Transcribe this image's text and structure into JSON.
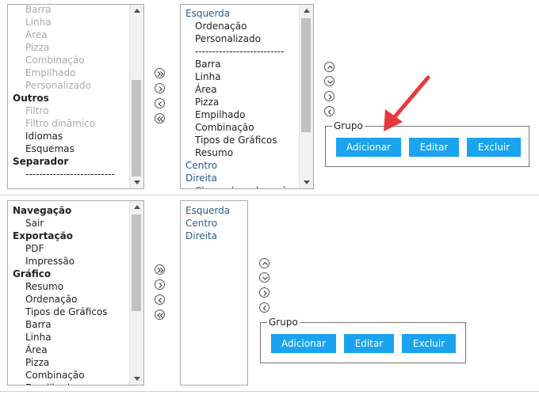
{
  "top": {
    "left_list": [
      {
        "label": "Barra",
        "kind": "disabled",
        "indent": 1
      },
      {
        "label": "Linha",
        "kind": "disabled",
        "indent": 1
      },
      {
        "label": "Área",
        "kind": "disabled",
        "indent": 1
      },
      {
        "label": "Pizza",
        "kind": "disabled",
        "indent": 1
      },
      {
        "label": "Combinação",
        "kind": "disabled",
        "indent": 1
      },
      {
        "label": "Empilhado",
        "kind": "disabled",
        "indent": 1
      },
      {
        "label": "Personalizado",
        "kind": "disabled",
        "indent": 1
      },
      {
        "label": "Outros",
        "kind": "group",
        "indent": 0
      },
      {
        "label": "Filtro",
        "kind": "disabled",
        "indent": 1
      },
      {
        "label": "Filtro dinâmico",
        "kind": "disabled",
        "indent": 1
      },
      {
        "label": "Idiomas",
        "kind": "active",
        "indent": 1
      },
      {
        "label": "Esquemas",
        "kind": "active",
        "indent": 1
      },
      {
        "label": "Separador",
        "kind": "group",
        "indent": 0
      },
      {
        "label": "--------------------------",
        "kind": "active",
        "indent": 1
      }
    ],
    "right_list": [
      {
        "label": "Esquerda",
        "kind": "blue",
        "indent": 0
      },
      {
        "label": "Ordenação",
        "kind": "active",
        "indent": 2
      },
      {
        "label": "Personalizado",
        "kind": "active",
        "indent": 2
      },
      {
        "label": "--------------------------",
        "kind": "active",
        "indent": 2
      },
      {
        "label": "Barra",
        "kind": "active",
        "indent": 2
      },
      {
        "label": "Linha",
        "kind": "active",
        "indent": 2
      },
      {
        "label": "Área",
        "kind": "active",
        "indent": 2
      },
      {
        "label": "Pizza",
        "kind": "active",
        "indent": 2
      },
      {
        "label": "Empilhado",
        "kind": "active",
        "indent": 2
      },
      {
        "label": "Combinação",
        "kind": "active",
        "indent": 2
      },
      {
        "label": "Tipos de Gráficos",
        "kind": "active",
        "indent": 2
      },
      {
        "label": "Resumo",
        "kind": "active",
        "indent": 2
      },
      {
        "label": "Centro",
        "kind": "blue",
        "indent": 0
      },
      {
        "label": "Direita",
        "kind": "blue",
        "indent": 0
      },
      {
        "label": "Chave de ordenação",
        "kind": "blue",
        "indent": 2
      }
    ],
    "group_legend": "Grupo",
    "buttons": {
      "add": "Adicionar",
      "edit": "Editar",
      "delete": "Excluir"
    }
  },
  "bottom": {
    "left_list": [
      {
        "label": "Navegação",
        "kind": "group",
        "indent": 0
      },
      {
        "label": "Sair",
        "kind": "active",
        "indent": 1
      },
      {
        "label": "Exportação",
        "kind": "group",
        "indent": 0
      },
      {
        "label": "PDF",
        "kind": "active",
        "indent": 1
      },
      {
        "label": "Impressão",
        "kind": "active",
        "indent": 1
      },
      {
        "label": "Gráfico",
        "kind": "group",
        "indent": 0
      },
      {
        "label": "Resumo",
        "kind": "active",
        "indent": 1
      },
      {
        "label": "Ordenação",
        "kind": "active",
        "indent": 1
      },
      {
        "label": "Tipos de Gráficos",
        "kind": "active",
        "indent": 1
      },
      {
        "label": "Barra",
        "kind": "active",
        "indent": 1
      },
      {
        "label": "Linha",
        "kind": "active",
        "indent": 1
      },
      {
        "label": "Área",
        "kind": "active",
        "indent": 1
      },
      {
        "label": "Pizza",
        "kind": "active",
        "indent": 1
      },
      {
        "label": "Combinação",
        "kind": "active",
        "indent": 1
      },
      {
        "label": "Empilhado",
        "kind": "active",
        "indent": 1
      }
    ],
    "right_list": [
      {
        "label": "Esquerda",
        "kind": "blue",
        "indent": 0
      },
      {
        "label": "Centro",
        "kind": "blue",
        "indent": 0
      },
      {
        "label": "Direita",
        "kind": "blue",
        "indent": 0
      }
    ],
    "group_legend": "Grupo",
    "buttons": {
      "add": "Adicionar",
      "edit": "Editar",
      "delete": "Excluir"
    }
  },
  "colors": {
    "button": "#1aa3ef",
    "annotation_arrow": "#e8393a",
    "section_blue": "#2b5c8a",
    "disabled": "#aaaaaa"
  },
  "icons": {
    "move_all_right": "double-chevron-right-icon",
    "move_right": "chevron-right-icon",
    "move_left": "chevron-left-icon",
    "move_all_left": "double-chevron-left-icon",
    "move_up": "chevron-up-icon",
    "move_down": "chevron-down-icon"
  }
}
